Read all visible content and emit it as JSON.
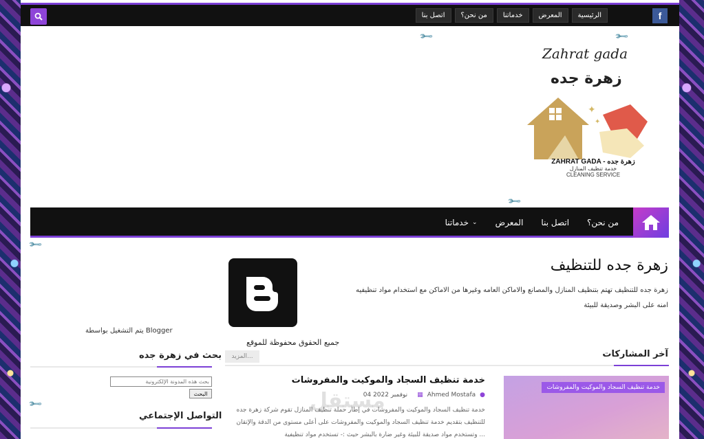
{
  "topbar": {
    "facebook_label": "f",
    "nav": [
      "الرئيسية",
      "المعرض",
      "خدماتنا",
      "من نحن؟",
      "اتصل بنا"
    ]
  },
  "logo": {
    "script": "Zahrat gada",
    "arabic": "زهرة جده",
    "line1": "ZAHRAT GADA - زهرة جده",
    "line2": "خدمة تنظيف المنازل",
    "line3": "CLEANING SERVICE"
  },
  "mainnav": {
    "items": [
      "من نحن؟",
      "اتصل بنا",
      "المعرض",
      "خدماتنا"
    ]
  },
  "site": {
    "title": "زهرة جده للتنظيف",
    "description": "زهرة جده للتنظيف تهتم بتنظيف المنازل والمصانع والاماكن العامه وغيرها من الاماكن مع استخدام مواد تنظيفيه امنه على البشر وصديقة للبيئة",
    "rights": "جميع الحقوق محفوظة للموقع",
    "powered": "يتم التشغيل بواسطة Blogger"
  },
  "latest": {
    "heading": "آخر المشاركات",
    "more": "المزيد..."
  },
  "search_widget": {
    "heading": "بحث في زهرة جده",
    "placeholder": "بحث هذه المدونة الإلكترونية",
    "button": "البحث"
  },
  "social_widget": {
    "heading": "التواصل الإجتماعي"
  },
  "post": {
    "thumb_label": "خدمة تنظيف السجاد والموكيت والمفروشات",
    "title": "خدمة تنظيف السجاد والموكيت والمفروشات",
    "author": "Ahmed Mostafa",
    "date": "04 نوفمبر 2022",
    "excerpt": "خدمة تنظيف السجاد والموكيت والمفروشات في إطار حملة تنظيف المنازل تقوم شركة زهرة جده للتنظيف بتقديم خدمة تنظيف السجاد والموكيت والمفروشات على أعلى مستوى من الدقة والإتقان وتستخدم مواد صديقة للبيئة وغير ضارة بالبشر حيث :- تستخدم مواد تنظيفية ..."
  },
  "watermark": "مستقل",
  "colors": {
    "accent": "#7b3fd6",
    "dark": "#111111",
    "facebook": "#3b5998"
  }
}
